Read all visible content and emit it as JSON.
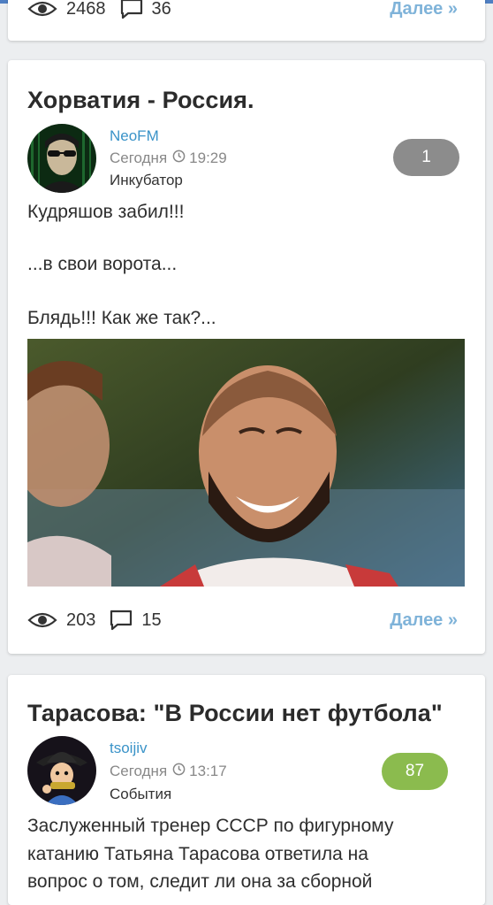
{
  "top_card": {
    "views": "2468",
    "comments": "36",
    "more_label": "Далее »"
  },
  "posts": [
    {
      "title": "Хорватия - Россия.",
      "author": "NeoFM",
      "day": "Сегодня",
      "time": "19:29",
      "category": "Инкубатор",
      "rating": "1",
      "rating_color": "#8c8c8c",
      "body": [
        "Кудряшов забил!!!",
        "...в свои ворота...",
        "Блядь!!! Как же так?..."
      ],
      "views": "203",
      "comments": "15",
      "more_label": "Далее »"
    },
    {
      "title": "Тарасова: \"В России нет футбола\"",
      "author": "tsoijiv",
      "day": "Сегодня",
      "time": "13:17",
      "category": "События",
      "rating": "87",
      "rating_color": "#8bbb4e",
      "body": [
        "Заслуженный тренер СССР по фигурному",
        "катанию Татьяна Тарасова ответила на",
        "вопрос о том, следит ли она за сборной"
      ]
    }
  ],
  "colors": {
    "link": "#3a93c8",
    "more": "#7fb3d9",
    "accent_bar": "#4f7fc3"
  },
  "icons": {
    "views": "eye-icon",
    "comments": "speech-bubble-icon",
    "time": "clock-icon"
  }
}
